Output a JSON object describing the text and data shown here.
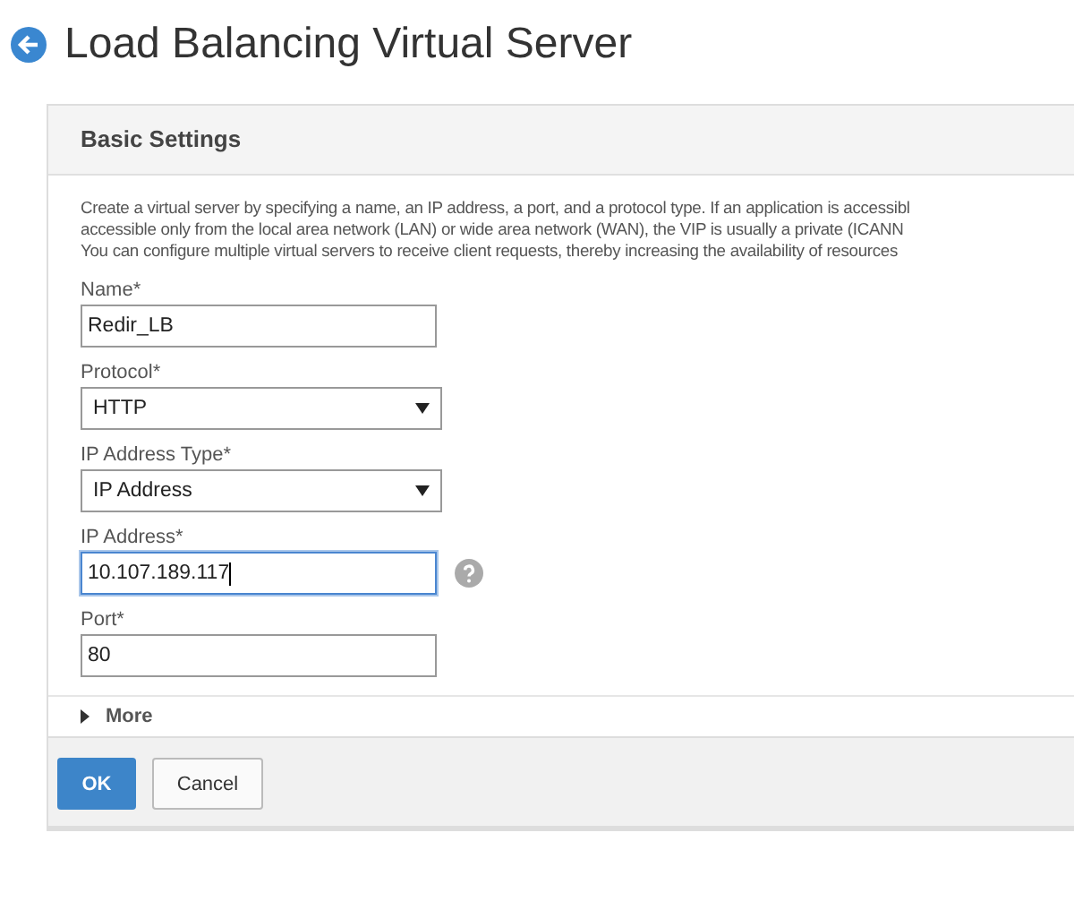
{
  "title": "Load Balancing Virtual Server",
  "section": {
    "title": "Basic Settings",
    "description": [
      "Create a virtual server by specifying a name, an IP address, a port, and a protocol type. If an application is accessibl",
      "accessible only from the local area network (LAN) or wide area network (WAN), the VIP is usually a private (ICANN",
      "You can configure multiple virtual servers to receive client requests, thereby increasing the availability of resources"
    ],
    "fields": [
      {
        "kind": "text",
        "label": "Name*",
        "value": "Redir_LB"
      },
      {
        "kind": "select",
        "label": "Protocol*",
        "value": "HTTP"
      },
      {
        "kind": "select",
        "label": "IP Address Type*",
        "value": "IP Address"
      },
      {
        "kind": "text",
        "label": "IP Address*",
        "value": "10.107.189.117",
        "focused": true,
        "help": true
      },
      {
        "kind": "text",
        "label": "Port*",
        "value": "80"
      }
    ],
    "more": {
      "label": "More",
      "expanded": false
    }
  },
  "buttons": [
    {
      "kind": "primary",
      "label": "OK"
    },
    {
      "kind": "secondary",
      "label": "Cancel"
    }
  ]
}
